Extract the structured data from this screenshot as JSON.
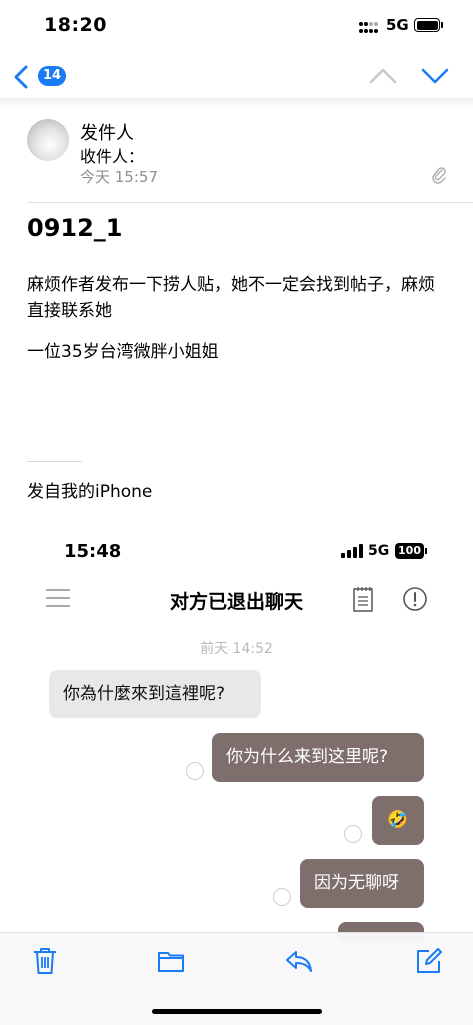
{
  "status_bar": {
    "time": "18:20",
    "network": "5G"
  },
  "nav": {
    "back_count": "14"
  },
  "header": {
    "sender": "发件人",
    "recipient": "收件人：",
    "date": "今天 15:57"
  },
  "email": {
    "subject": "0912_1",
    "body_line1": "麻烦作者发布一下捞人贴，她不一定会找到帖子，麻烦直接联系她",
    "body_line2": "一位35岁台湾微胖小姐姐",
    "signature": "发自我的iPhone"
  },
  "embedded_chat": {
    "status_time": "15:48",
    "network": "5G",
    "battery": "100",
    "title": "对方已退出聊天",
    "date": "前天 14:52",
    "messages": [
      {
        "side": "incoming",
        "text": "你為什麼來到這裡呢?"
      },
      {
        "side": "outgoing",
        "text": "你为什么来到这里呢?"
      },
      {
        "side": "outgoing",
        "text": "🤣"
      },
      {
        "side": "outgoing",
        "text": "因为无聊呀"
      }
    ]
  },
  "colors": {
    "accent": "#1a7cf4",
    "outgoing_bubble": "#7e6f6c",
    "incoming_bubble": "#e8e8e8"
  },
  "icons": [
    "back-chevron-icon",
    "chevron-up-icon",
    "chevron-down-icon",
    "paperclip-icon",
    "menu-icon",
    "notes-icon",
    "info-icon",
    "trash-icon",
    "folder-icon",
    "reply-icon",
    "compose-icon"
  ]
}
